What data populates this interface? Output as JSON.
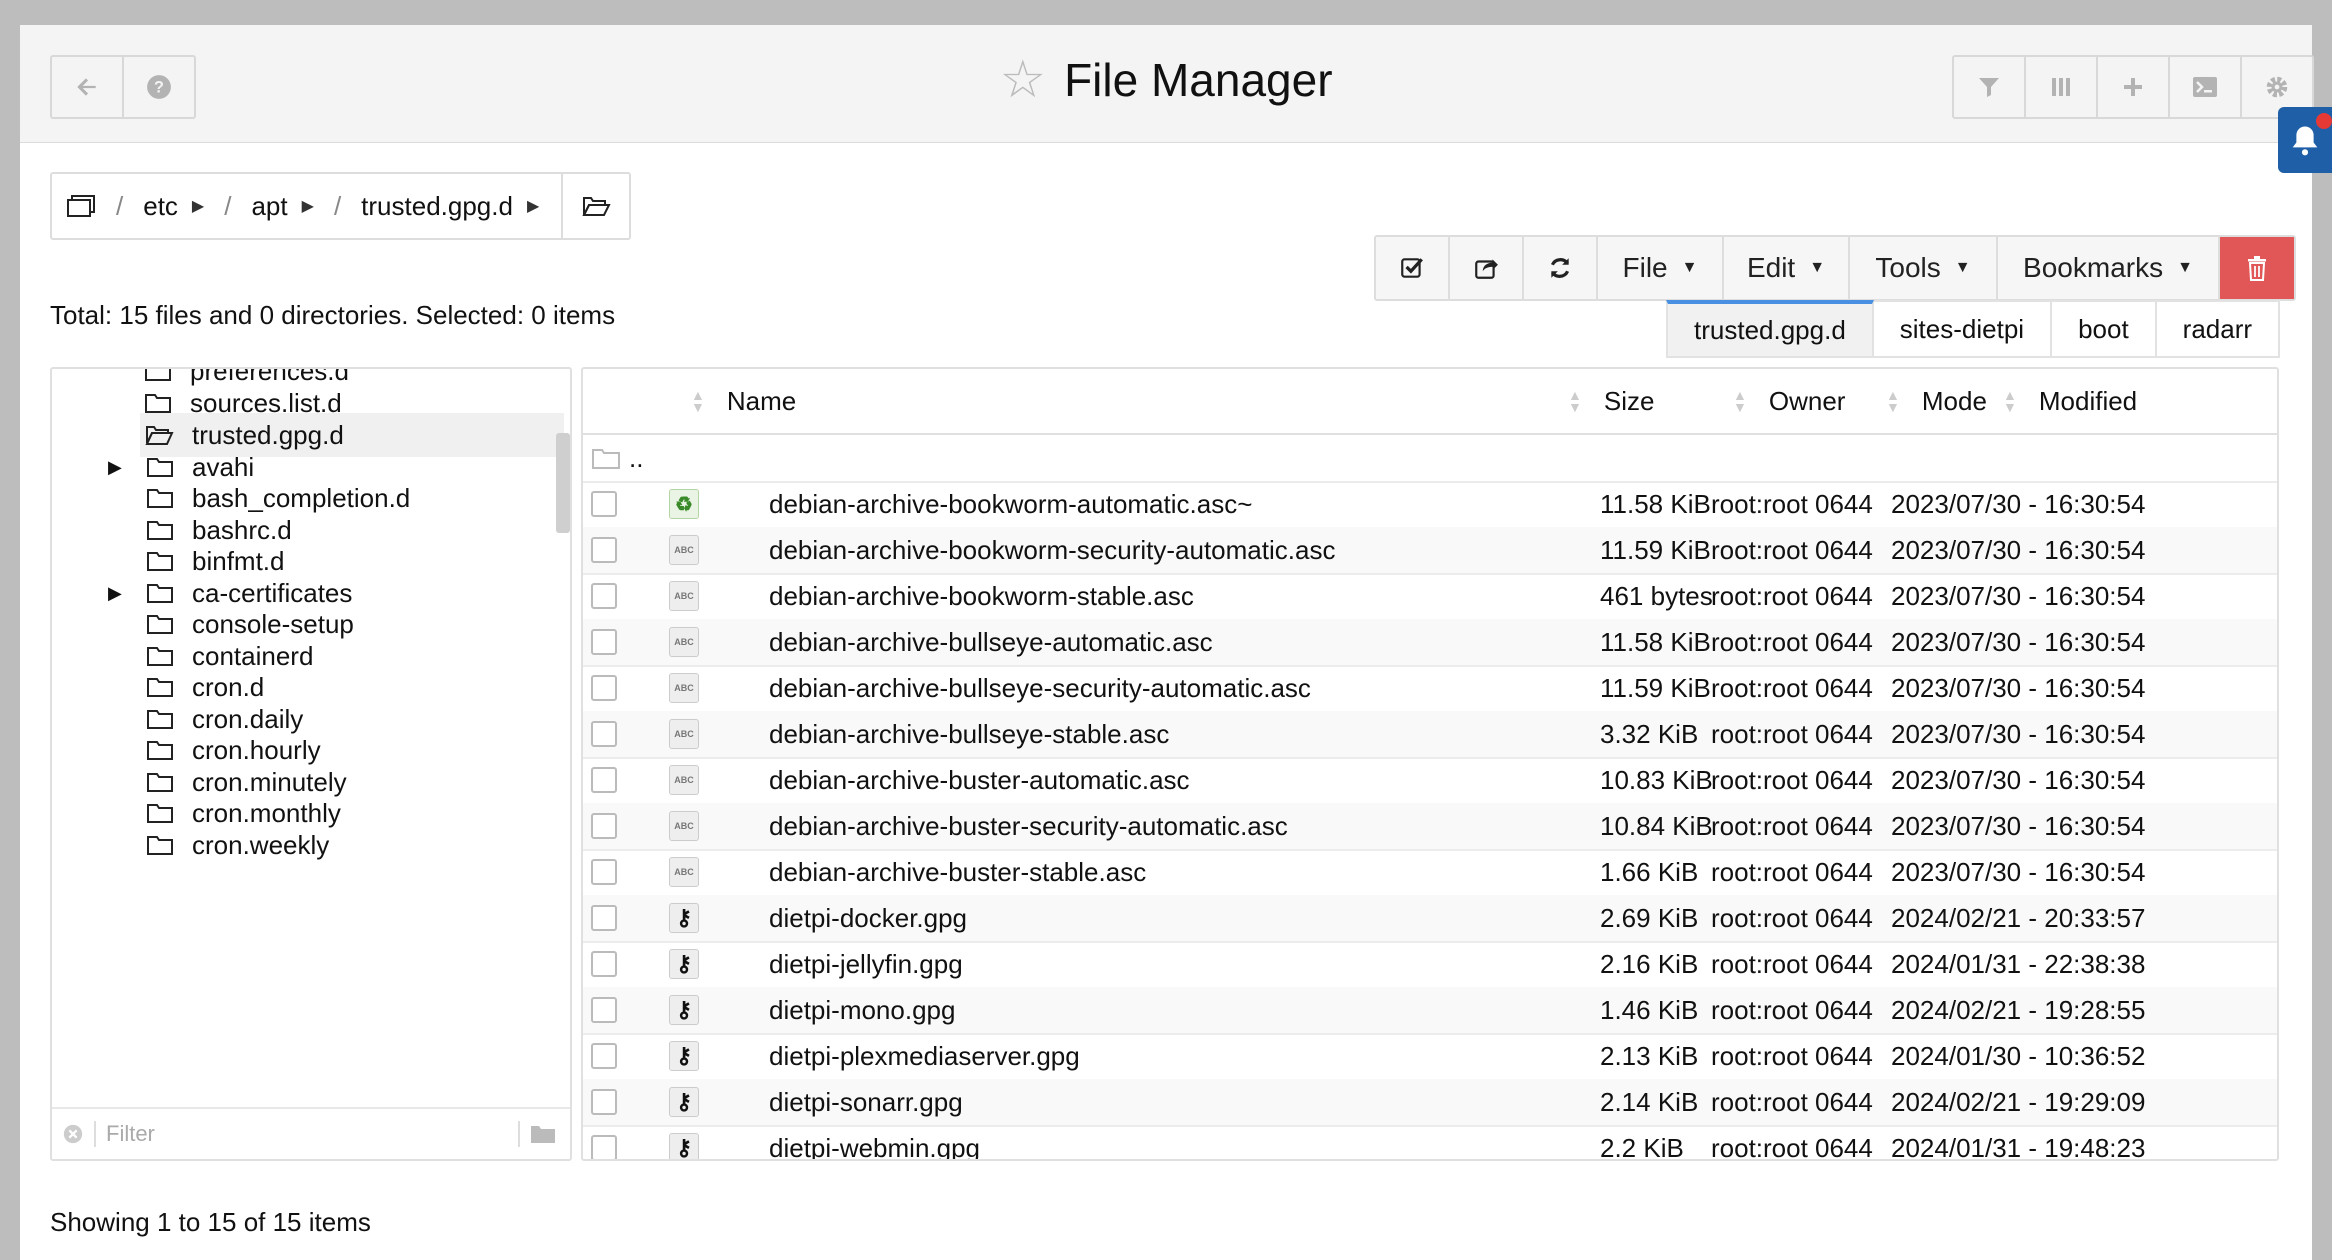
{
  "header": {
    "title": "File Manager",
    "left_buttons": [
      "back-arrow-icon",
      "help-icon"
    ],
    "right_buttons": [
      "filter-icon",
      "columns-icon",
      "plus-icon",
      "terminal-icon",
      "gear-icon"
    ]
  },
  "breadcrumb": {
    "segments": [
      "etc",
      "apt",
      "trusted.gpg.d"
    ]
  },
  "toolbar": {
    "file_label": "File",
    "edit_label": "Edit",
    "tools_label": "Tools",
    "bookmarks_label": "Bookmarks"
  },
  "status": {
    "total": "Total: 15 files and 0 directories. Selected: 0 items",
    "showing": "Showing 1 to 15 of 15 items"
  },
  "tabs": [
    "trusted.gpg.d",
    "sites-dietpi",
    "boot",
    "radarr"
  ],
  "tree": {
    "items": [
      {
        "label": "preferences.d"
      },
      {
        "label": "sources.list.d"
      },
      {
        "label": "trusted.gpg.d"
      },
      {
        "label": "avahi"
      },
      {
        "label": "bash_completion.d"
      },
      {
        "label": "bashrc.d"
      },
      {
        "label": "binfmt.d"
      },
      {
        "label": "ca-certificates"
      },
      {
        "label": "console-setup"
      },
      {
        "label": "containerd"
      },
      {
        "label": "cron.d"
      },
      {
        "label": "cron.daily"
      },
      {
        "label": "cron.hourly"
      },
      {
        "label": "cron.minutely"
      },
      {
        "label": "cron.monthly"
      },
      {
        "label": "cron.weekly"
      }
    ],
    "filter_placeholder": "Filter"
  },
  "table": {
    "columns": {
      "name": "Name",
      "size": "Size",
      "owner": "Owner",
      "mode": "Mode",
      "modified": "Modified"
    },
    "parent_dir": "..",
    "rows": [
      {
        "name": "debian-archive-bookworm-automatic.asc~",
        "size": "11.58 KiB",
        "owner": "root:root",
        "mode": "0644",
        "modified": "2023/07/30 - 16:30:54",
        "icon": "backup"
      },
      {
        "name": "debian-archive-bookworm-security-automatic.asc",
        "size": "11.59 KiB",
        "owner": "root:root",
        "mode": "0644",
        "modified": "2023/07/30 - 16:30:54",
        "icon": "text"
      },
      {
        "name": "debian-archive-bookworm-stable.asc",
        "size": "461 bytes",
        "owner": "root:root",
        "mode": "0644",
        "modified": "2023/07/30 - 16:30:54",
        "icon": "text"
      },
      {
        "name": "debian-archive-bullseye-automatic.asc",
        "size": "11.58 KiB",
        "owner": "root:root",
        "mode": "0644",
        "modified": "2023/07/30 - 16:30:54",
        "icon": "text"
      },
      {
        "name": "debian-archive-bullseye-security-automatic.asc",
        "size": "11.59 KiB",
        "owner": "root:root",
        "mode": "0644",
        "modified": "2023/07/30 - 16:30:54",
        "icon": "text"
      },
      {
        "name": "debian-archive-bullseye-stable.asc",
        "size": "3.32 KiB",
        "owner": "root:root",
        "mode": "0644",
        "modified": "2023/07/30 - 16:30:54",
        "icon": "text"
      },
      {
        "name": "debian-archive-buster-automatic.asc",
        "size": "10.83 KiB",
        "owner": "root:root",
        "mode": "0644",
        "modified": "2023/07/30 - 16:30:54",
        "icon": "text"
      },
      {
        "name": "debian-archive-buster-security-automatic.asc",
        "size": "10.84 KiB",
        "owner": "root:root",
        "mode": "0644",
        "modified": "2023/07/30 - 16:30:54",
        "icon": "text"
      },
      {
        "name": "debian-archive-buster-stable.asc",
        "size": "1.66 KiB",
        "owner": "root:root",
        "mode": "0644",
        "modified": "2023/07/30 - 16:30:54",
        "icon": "text"
      },
      {
        "name": "dietpi-docker.gpg",
        "size": "2.69 KiB",
        "owner": "root:root",
        "mode": "0644",
        "modified": "2024/02/21 - 20:33:57",
        "icon": "key"
      },
      {
        "name": "dietpi-jellyfin.gpg",
        "size": "2.16 KiB",
        "owner": "root:root",
        "mode": "0644",
        "modified": "2024/01/31 - 22:38:38",
        "icon": "key"
      },
      {
        "name": "dietpi-mono.gpg",
        "size": "1.46 KiB",
        "owner": "root:root",
        "mode": "0644",
        "modified": "2024/02/21 - 19:28:55",
        "icon": "key"
      },
      {
        "name": "dietpi-plexmediaserver.gpg",
        "size": "2.13 KiB",
        "owner": "root:root",
        "mode": "0644",
        "modified": "2024/01/30 - 10:36:52",
        "icon": "key"
      },
      {
        "name": "dietpi-sonarr.gpg",
        "size": "2.14 KiB",
        "owner": "root:root",
        "mode": "0644",
        "modified": "2024/02/21 - 19:29:09",
        "icon": "key"
      },
      {
        "name": "dietpi-webmin.gpg",
        "size": "2.2 KiB",
        "owner": "root:root",
        "mode": "0644",
        "modified": "2024/01/31 - 19:48:23",
        "icon": "key"
      }
    ]
  },
  "colors": {
    "accent": "#4a90e2",
    "delete": "#e15656",
    "notification": "#1f5fa8"
  }
}
